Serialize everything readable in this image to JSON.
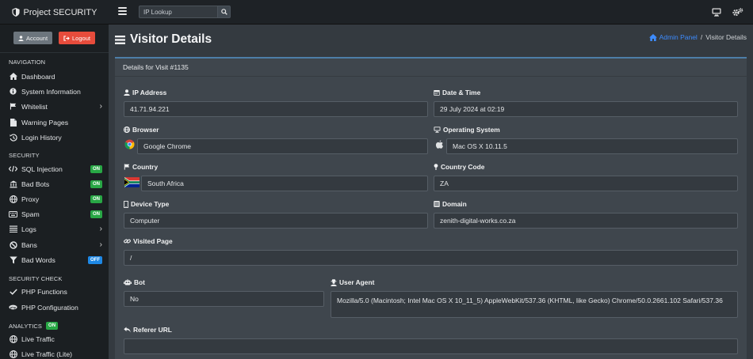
{
  "app": {
    "title": "Project SECURITY"
  },
  "search": {
    "placeholder": "IP Lookup"
  },
  "sidebar": {
    "account_label": "Account",
    "logout_label": "Logout",
    "sections": {
      "navigation": "NAVIGATION",
      "security": "SECURITY",
      "security_check": "SECURITY CHECK",
      "analytics": "ANALYTICS",
      "analytics_badge": "ON"
    },
    "nav": [
      {
        "label": "Dashboard",
        "icon": "home-icon"
      },
      {
        "label": "System Information",
        "icon": "info-icon"
      },
      {
        "label": "Whitelist",
        "icon": "flag-icon",
        "chevron": true
      },
      {
        "label": "Warning Pages",
        "icon": "file-icon"
      },
      {
        "label": "Login History",
        "icon": "history-icon"
      }
    ],
    "security": [
      {
        "label": "SQL Injection",
        "icon": "code-icon",
        "badge": "ON"
      },
      {
        "label": "Bad Bots",
        "icon": "bank-icon",
        "badge": "ON"
      },
      {
        "label": "Proxy",
        "icon": "globe-icon",
        "badge": "ON"
      },
      {
        "label": "Spam",
        "icon": "keyboard-icon",
        "badge": "ON"
      },
      {
        "label": "Logs",
        "icon": "list-icon",
        "chevron": true
      },
      {
        "label": "Bans",
        "icon": "ban-icon",
        "chevron": true
      },
      {
        "label": "Bad Words",
        "icon": "filter-icon",
        "badge": "OFF"
      }
    ],
    "security_check": [
      {
        "label": "PHP Functions",
        "icon": "check-icon"
      },
      {
        "label": "PHP Configuration",
        "icon": "php-icon"
      }
    ],
    "analytics": [
      {
        "label": "Live Traffic",
        "icon": "globe-icon"
      },
      {
        "label": "Live Traffic (Lite)",
        "icon": "globe-icon"
      }
    ]
  },
  "page": {
    "title": "Visitor Details",
    "breadcrumb_home": "Admin Panel",
    "breadcrumb_sep": "/",
    "breadcrumb_current": "Visitor Details",
    "card_header": "Details for Visit #1135"
  },
  "fields": {
    "ip_address": {
      "label": "IP Address",
      "value": "41.71.94.221"
    },
    "date_time": {
      "label": "Date & Time",
      "value": "29 July 2024 at 02:19"
    },
    "browser": {
      "label": "Browser",
      "value": "Google Chrome"
    },
    "os": {
      "label": "Operating System",
      "value": "Mac OS X 10.11.5"
    },
    "country": {
      "label": "Country",
      "value": "South Africa"
    },
    "country_code": {
      "label": "Country Code",
      "value": "ZA"
    },
    "device_type": {
      "label": "Device Type",
      "value": "Computer"
    },
    "domain": {
      "label": "Domain",
      "value": "zenith-digital-works.co.za"
    },
    "visited_page": {
      "label": "Visited Page",
      "value": "/"
    },
    "bot": {
      "label": "Bot",
      "value": "No"
    },
    "user_agent": {
      "label": "User Agent",
      "value": "Mozilla/5.0 (Macintosh; Intel Mac OS X 10_11_5) AppleWebKit/537.36 (KHTML, like Gecko) Chrome/50.0.2661.102 Safari/537.36"
    },
    "referer_url": {
      "label": "Referer URL",
      "value": ""
    }
  },
  "colors": {
    "logout": "#e74c3c",
    "badge_on": "#28a745",
    "badge_off": "#1e88e5",
    "link": "#3d8bfd",
    "card_accent": "#4d7ea8"
  }
}
